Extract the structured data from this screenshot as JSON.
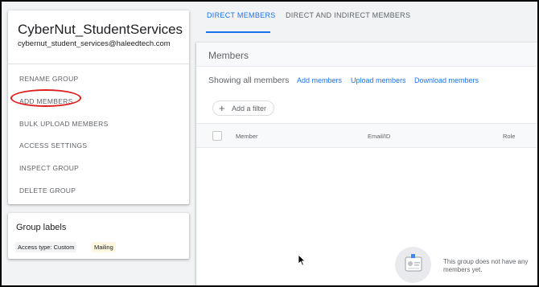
{
  "group": {
    "name": "CyberNut_StudentServices",
    "email": "cybernut_student_services@haleedtech.com"
  },
  "menu": {
    "items": [
      {
        "label": "RENAME GROUP"
      },
      {
        "label": "ADD MEMBERS"
      },
      {
        "label": "BULK UPLOAD MEMBERS"
      },
      {
        "label": "ACCESS SETTINGS"
      },
      {
        "label": "INSPECT GROUP"
      },
      {
        "label": "DELETE GROUP"
      }
    ],
    "highlighted": "ADD MEMBERS",
    "highlight_color": "#e01b1b"
  },
  "labels": {
    "title": "Group labels",
    "chips": [
      {
        "text": "Access type: Custom",
        "color": "#f1f3f4"
      },
      {
        "text": "Mailing",
        "color": "#fef7e0"
      }
    ]
  },
  "tabs": [
    {
      "label": "DIRECT MEMBERS",
      "active": true
    },
    {
      "label": "DIRECT AND INDIRECT MEMBERS",
      "active": false
    }
  ],
  "members": {
    "title": "Members",
    "showing": "Showing all members",
    "actions": {
      "add": "Add members",
      "upload": "Upload members",
      "download": "Download members"
    },
    "filter": {
      "icon": "plus-icon",
      "label": "Add a filter"
    },
    "columns": [
      "Member",
      "Email/ID",
      "Role"
    ],
    "empty_message": "This group does not have any members yet."
  },
  "colors": {
    "accent": "#1a73e8",
    "text_secondary": "#5f6368",
    "background": "#f1f3f4"
  }
}
